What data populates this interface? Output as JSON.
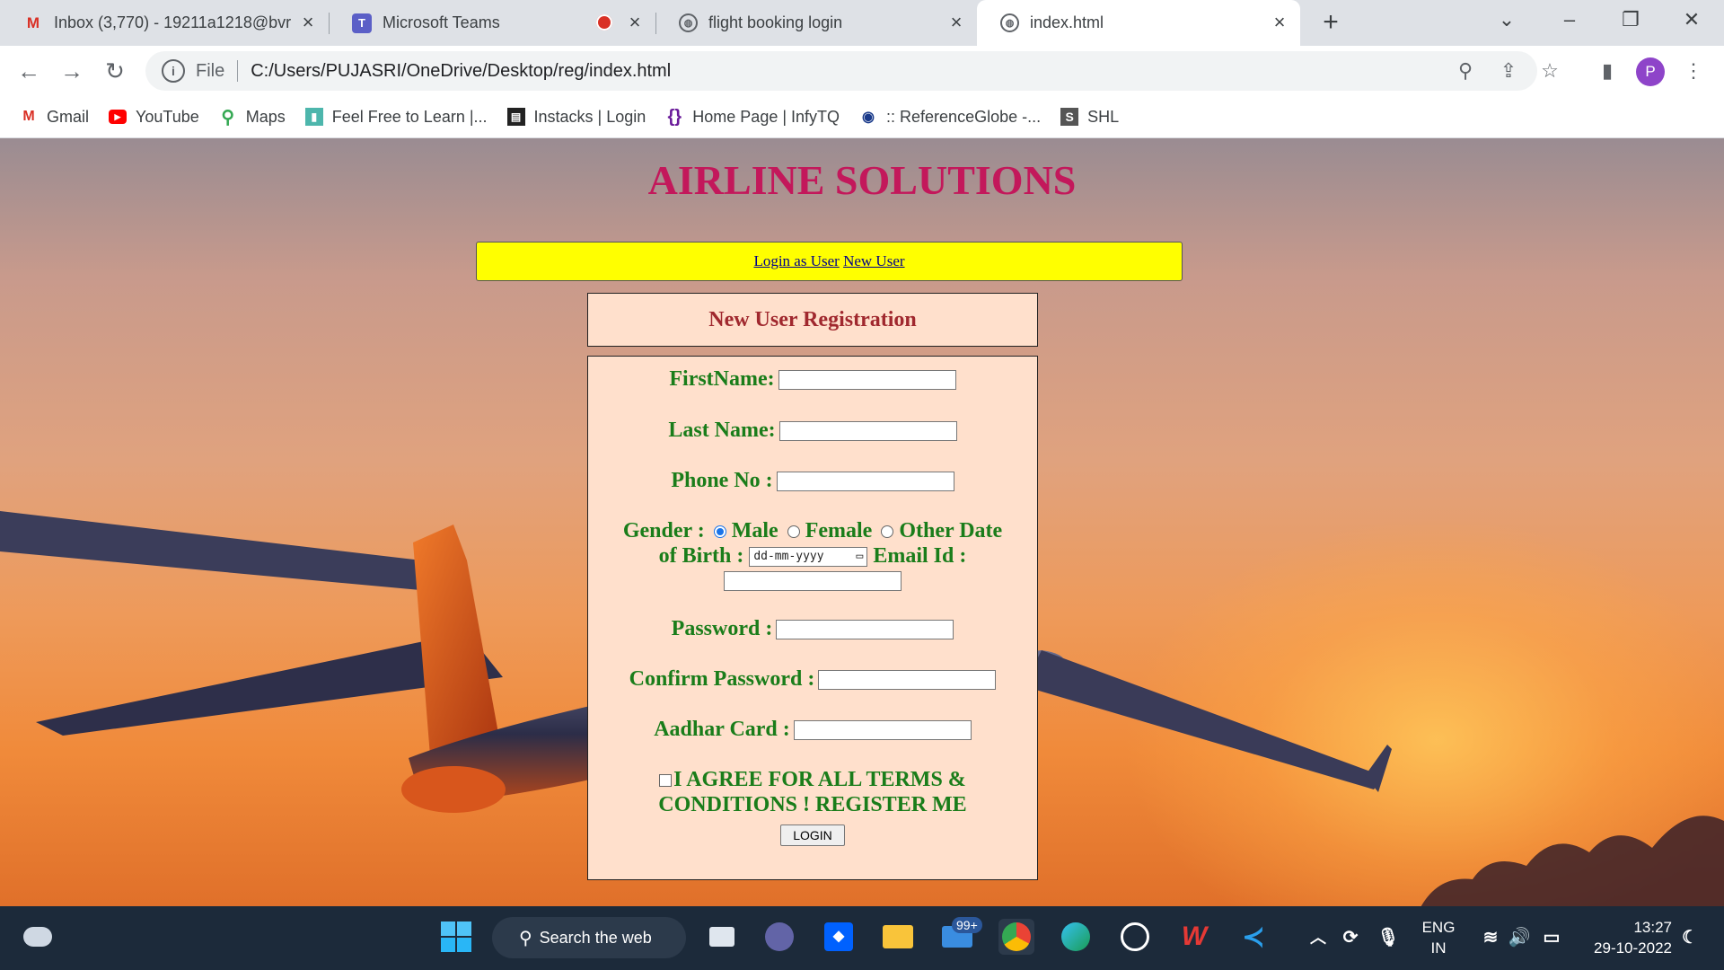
{
  "browser": {
    "tabs": [
      {
        "icon": "gmail-icon",
        "title": "Inbox (3,770) - 19211a1218@bvr"
      },
      {
        "icon": "teams-icon",
        "title": "Microsoft Teams"
      },
      {
        "icon": "globe-icon",
        "title": "flight booking login"
      },
      {
        "icon": "globe-icon",
        "title": "index.html",
        "active": true
      }
    ],
    "address": {
      "scheme_label": "File",
      "url": "C:/Users/PUJASRI/OneDrive/Desktop/reg/index.html"
    },
    "profile_initial": "P",
    "bookmarks": [
      {
        "icon": "gmail-icon",
        "label": "Gmail"
      },
      {
        "icon": "youtube-icon",
        "label": "YouTube"
      },
      {
        "icon": "maps-icon",
        "label": "Maps"
      },
      {
        "icon": "bookmark-icon",
        "label": "Feel Free to Learn |..."
      },
      {
        "icon": "instacks-icon",
        "label": "Instacks | Login"
      },
      {
        "icon": "infytq-icon",
        "label": "Home Page | InfyTQ"
      },
      {
        "icon": "referenceglobe-icon",
        "label": ":: ReferenceGlobe -..."
      },
      {
        "icon": "shl-icon",
        "label": "SHL"
      }
    ]
  },
  "page": {
    "headline": "AIRLINE SOLUTIONS",
    "nav": {
      "login_link": "Login as User",
      "new_user_link": "New User"
    },
    "section_title": "New User Registration",
    "form": {
      "first_name_label": "FirstName:",
      "last_name_label": "Last Name:",
      "phone_label": "Phone No :",
      "gender_label": "Gender :",
      "gender_options": [
        "Male",
        "Female",
        "Other"
      ],
      "gender_selected": "Male",
      "dob_label_1": "Date",
      "dob_label_2": "of Birth :",
      "dob_placeholder": "dd-mm-yyyy",
      "email_label": "Email Id :",
      "password_label": "Password :",
      "confirm_password_label": "Confirm Password :",
      "aadhar_label": "Aadhar Card :",
      "terms_line_1": "I AGREE FOR ALL TERMS &",
      "terms_line_2": "CONDITIONS ! REGISTER ME",
      "submit_label": "LOGIN"
    },
    "colors": {
      "headline": "#c3185b",
      "nav_bg": "#ffff00",
      "form_bg": "#ffe0cc",
      "form_text": "#1a7d1a",
      "section_title": "#a0282e"
    }
  },
  "taskbar": {
    "search_label": "Search the web",
    "mail_badge": "99+",
    "language": [
      "ENG",
      "IN"
    ],
    "time": "13:27",
    "date": "29-10-2022"
  }
}
